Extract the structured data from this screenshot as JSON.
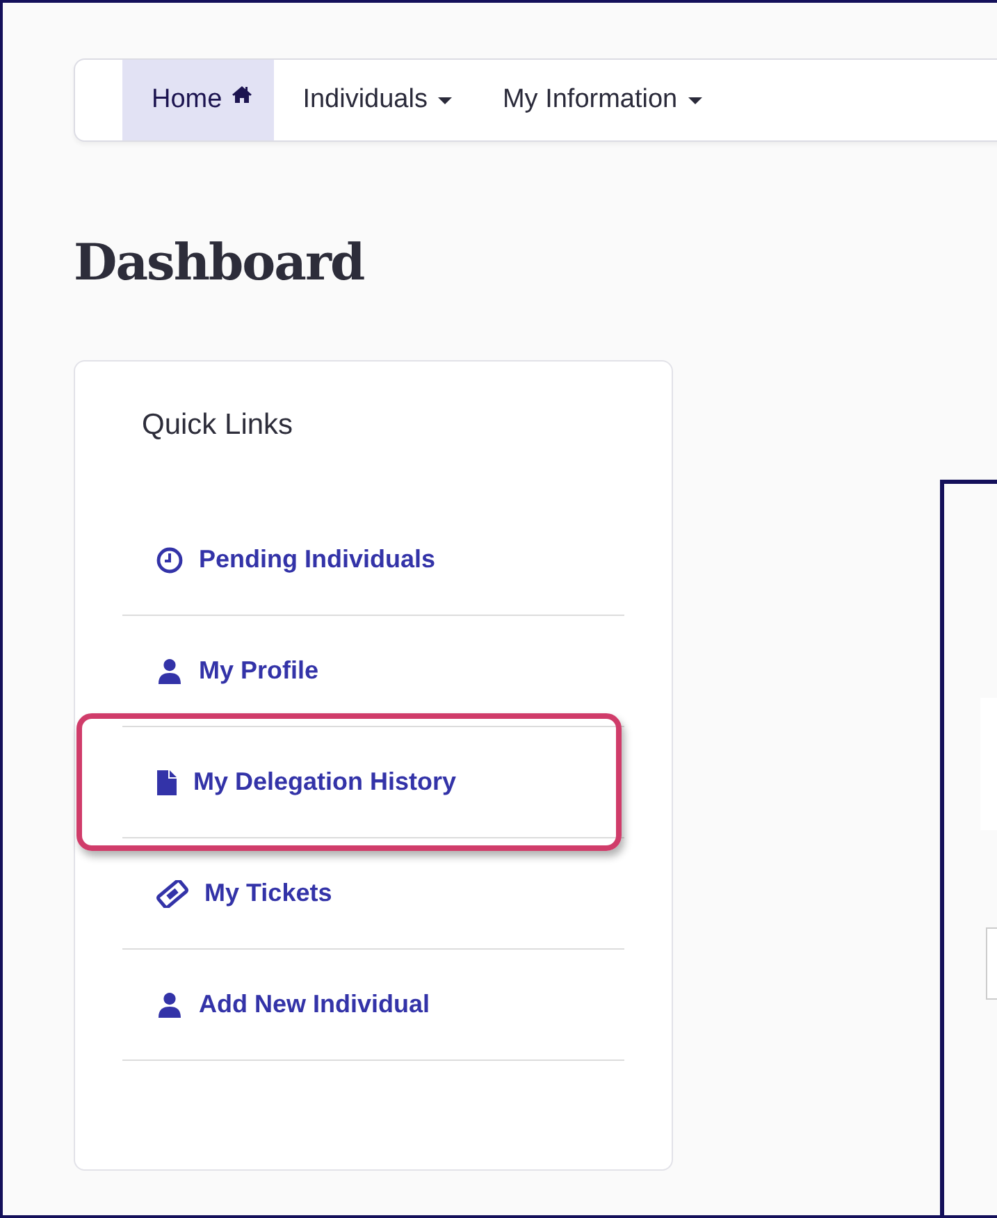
{
  "navbar": {
    "items": [
      {
        "label": "Home",
        "kind": "home",
        "selected": true
      },
      {
        "label": "Individuals",
        "kind": "dropdown",
        "selected": false
      },
      {
        "label": "My Information",
        "kind": "dropdown",
        "selected": false
      }
    ]
  },
  "page_title": "Dashboard",
  "quick_links": {
    "title": "Quick Links",
    "items": [
      {
        "label": "Pending Individuals",
        "kind": "clock",
        "highlighted": false
      },
      {
        "label": "My Profile",
        "kind": "user",
        "highlighted": false
      },
      {
        "label": "My Delegation History",
        "kind": "file",
        "highlighted": true
      },
      {
        "label": "My Tickets",
        "kind": "ticket",
        "highlighted": false
      },
      {
        "label": "Add New Individual",
        "kind": "user",
        "highlighted": false
      }
    ]
  }
}
